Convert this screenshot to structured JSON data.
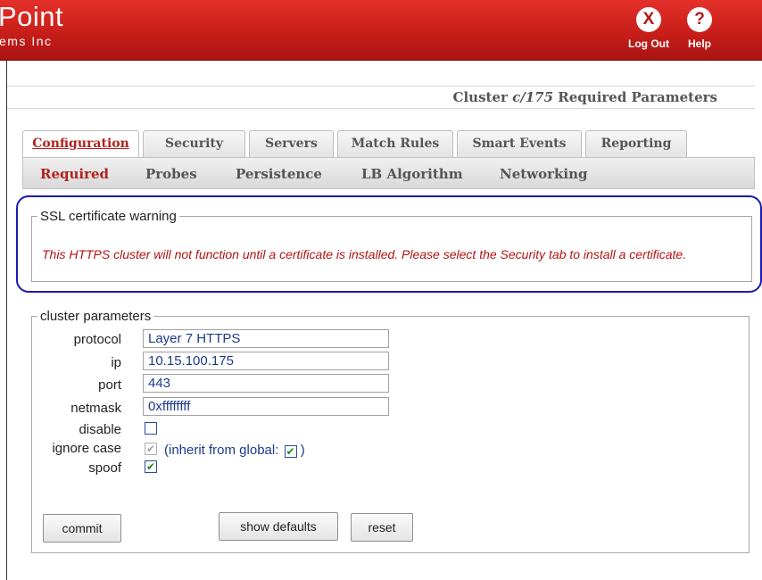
{
  "header": {
    "brand": "Point",
    "subtitle": "ems Inc",
    "logout": {
      "icon": "X",
      "label": "Log Out"
    },
    "help": {
      "icon": "?",
      "label": "Help"
    }
  },
  "page_title": {
    "prefix": "Cluster ",
    "name": "c/175",
    "suffix": " Required Parameters"
  },
  "tabs": [
    "Configuration",
    "Security",
    "Servers",
    "Match Rules",
    "Smart Events",
    "Reporting"
  ],
  "subtabs": [
    "Required",
    "Probes",
    "Persistence",
    "LB Algorithm",
    "Networking"
  ],
  "warning": {
    "legend": "SSL certificate warning",
    "message": "This HTTPS cluster will not function until a certificate is installed. Please select the Security tab to install a certificate."
  },
  "params": {
    "legend": "cluster parameters",
    "protocol": {
      "label": "protocol",
      "value": "Layer 7 HTTPS"
    },
    "ip": {
      "label": "ip",
      "value": "10.15.100.175"
    },
    "port": {
      "label": "port",
      "value": "443"
    },
    "netmask": {
      "label": "netmask",
      "value": "0xffffffff"
    },
    "disable": {
      "label": "disable"
    },
    "ignore_case": {
      "label": "ignore case",
      "inherit_text": "(inherit from global:",
      "close": ")"
    },
    "spoof": {
      "label": "spoof"
    }
  },
  "checkmark": "✔",
  "buttons": {
    "commit": "commit",
    "show_defaults": "show defaults",
    "reset": "reset"
  },
  "colors": {
    "header_red": "#c81e1a",
    "active_tab": "#b3221e",
    "warning_text": "#b2140f",
    "highlight_ring": "#1a1ab5"
  }
}
